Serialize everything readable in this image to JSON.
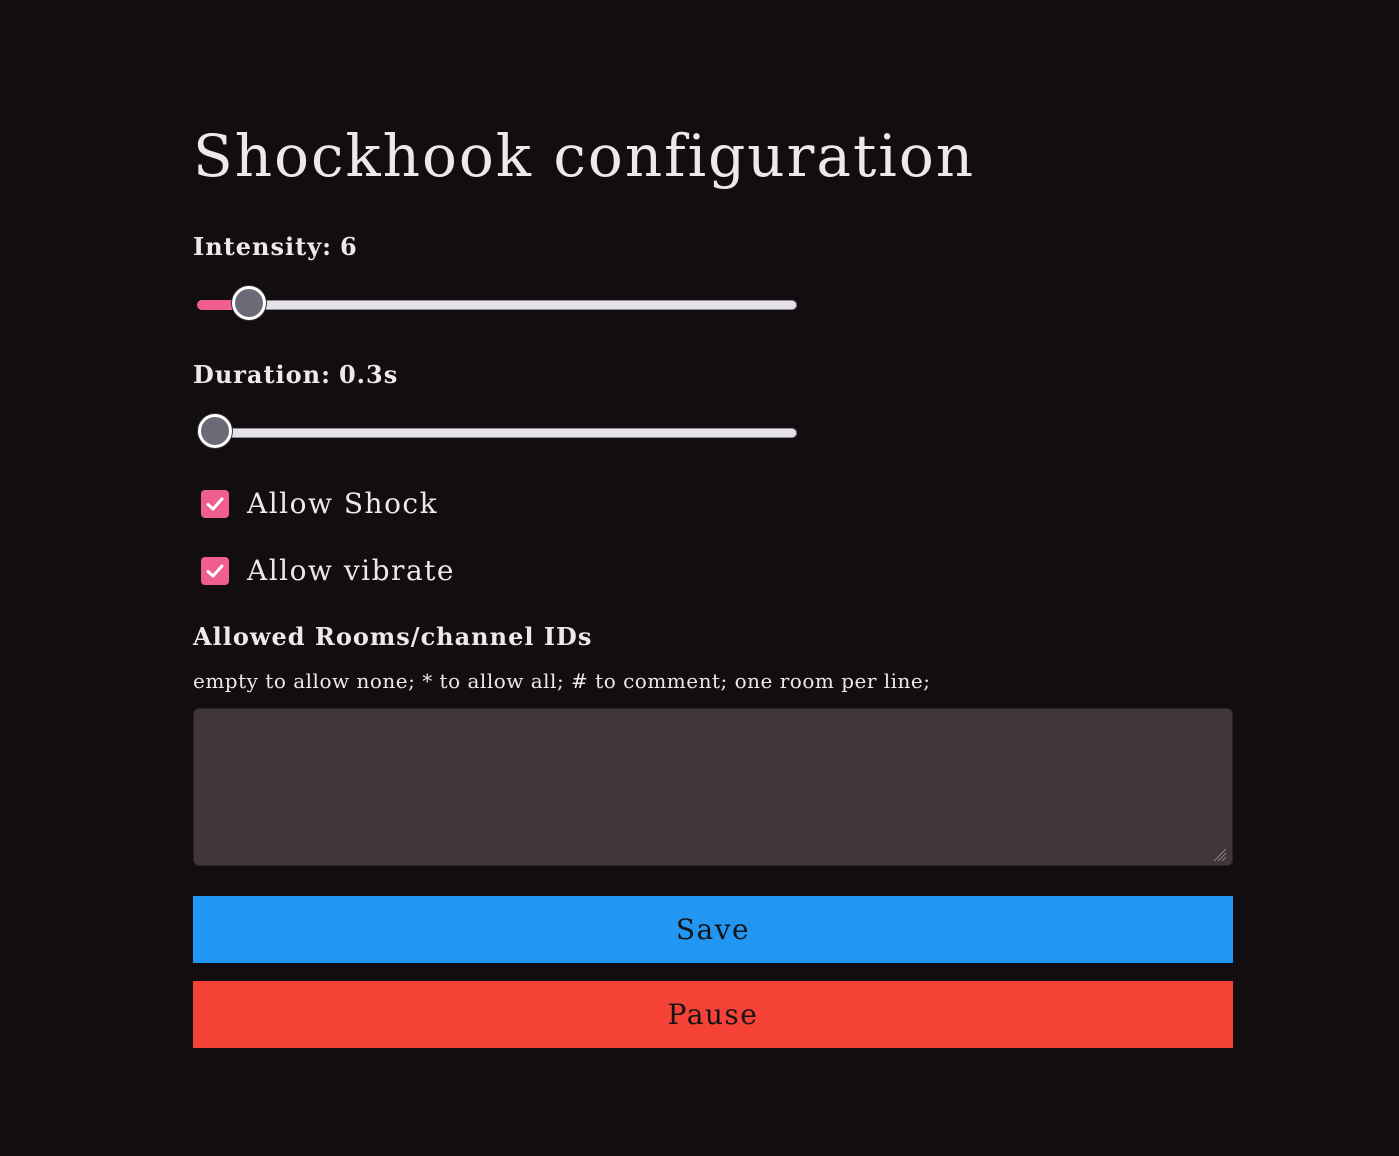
{
  "page": {
    "title": "Shockhook configuration"
  },
  "intensity": {
    "label": "Intensity:",
    "value": "6",
    "min": 0,
    "max": 100,
    "level": 6,
    "fill_color": "#ef5e8e"
  },
  "duration": {
    "label": "Duration:",
    "value": "0.3s",
    "min": 0.3,
    "max": 30,
    "level": 0.3
  },
  "checkboxes": {
    "allow_shock": {
      "label": "Allow Shock",
      "checked": true,
      "icon": "check-icon"
    },
    "allow_vibrate": {
      "label": "Allow vibrate",
      "checked": true,
      "icon": "check-icon"
    }
  },
  "rooms": {
    "label": "Allowed Rooms/channel IDs",
    "hint": "empty to allow none; * to allow all; # to comment; one room per line;",
    "value": ""
  },
  "buttons": {
    "save_label": "Save",
    "save_color": "#2196f3",
    "pause_label": "Pause",
    "pause_color": "#f44336"
  },
  "theme": {
    "background": "#120d10",
    "accent": "#ef5e8e",
    "textarea_bg": "#40353a"
  }
}
